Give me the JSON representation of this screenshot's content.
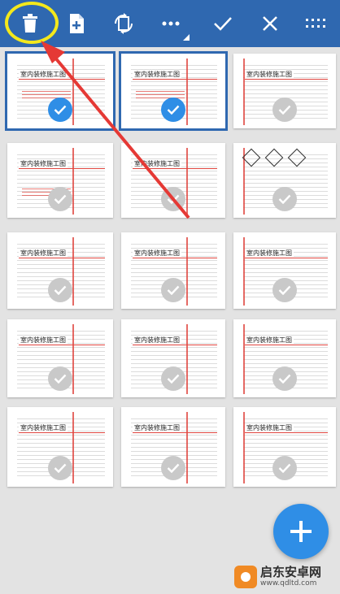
{
  "toolbar": {
    "icons": [
      "trash-icon",
      "add-page-icon",
      "rotate-page-icon",
      "more-icon",
      "confirm-icon",
      "close-icon",
      "grid-view-icon"
    ]
  },
  "pages": [
    {
      "title": "室内装修施工图",
      "selected": true
    },
    {
      "title": "室内装修施工图",
      "selected": true
    },
    {
      "title": "室内装修施工图",
      "selected": false
    },
    {
      "title": "室内装修施工图",
      "selected": false
    },
    {
      "title": "室内装修施工图",
      "selected": false
    },
    {
      "title": "",
      "selected": false
    },
    {
      "title": "室内装修施工图",
      "selected": false
    },
    {
      "title": "室内装修施工图",
      "selected": false
    },
    {
      "title": "室内装修施工图",
      "selected": false
    },
    {
      "title": "室内装修施工图",
      "selected": false
    },
    {
      "title": "室内装修施工图",
      "selected": false
    },
    {
      "title": "室内装修施工图",
      "selected": false
    },
    {
      "title": "室内装修施工图",
      "selected": false
    },
    {
      "title": "室内装修施工图",
      "selected": false
    },
    {
      "title": "室内装修施工图",
      "selected": false
    }
  ],
  "fab": {
    "icon": "plus-icon"
  },
  "watermark": {
    "title": "启东安卓网",
    "url": "www.qdltd.com"
  },
  "colors": {
    "toolbar": "#2f68b0",
    "accent": "#2f8ee6",
    "highlight": "#f3e81c",
    "arrow": "#e53935"
  }
}
